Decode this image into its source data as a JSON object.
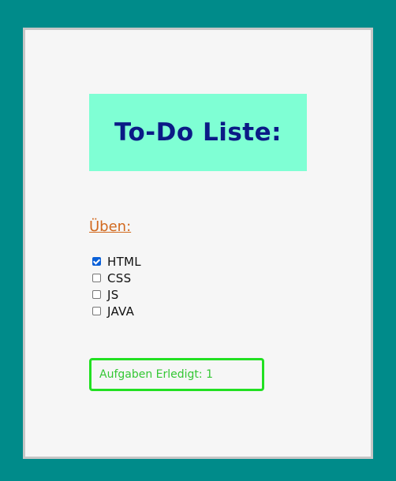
{
  "title": "To-Do Liste:",
  "section": {
    "heading": "Üben:"
  },
  "tasks": [
    {
      "label": "HTML",
      "checked": true
    },
    {
      "label": "CSS",
      "checked": false
    },
    {
      "label": "JS",
      "checked": false
    },
    {
      "label": "JAVA",
      "checked": false
    }
  ],
  "status": {
    "text": "Aufgaben Erledigt: 1"
  },
  "colors": {
    "page_background": "#008b8a",
    "card_background": "#f6f6f6",
    "title_background": "#7fffd4",
    "title_text": "#0b1a86",
    "heading_text": "#d2691e",
    "status_border": "#22e022",
    "status_text": "#34c734",
    "checkbox_checked": "#0a60d8"
  }
}
